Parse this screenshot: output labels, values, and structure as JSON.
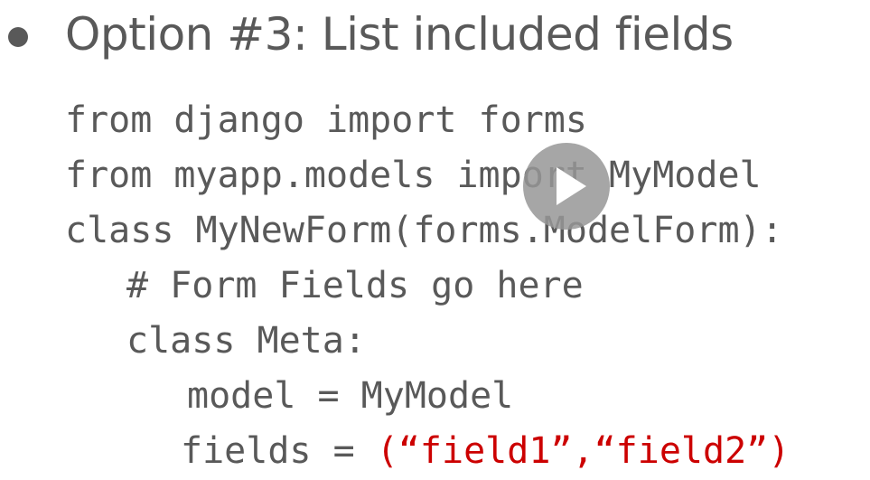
{
  "slide": {
    "heading": "Option #3: List included fields",
    "code_lines": [
      "from django import forms",
      "from myapp.models import MyModel",
      "class MyNewForm(forms.ModelForm):",
      "# Form Fields go here",
      "class Meta:",
      "model = MyModel",
      "fields = "
    ],
    "fields_value": "(“field1”,“field2”)"
  },
  "player": {
    "play_icon": "play-icon"
  },
  "colors": {
    "text": "#595959",
    "highlight": "#cc0000",
    "play_button": "#969696"
  }
}
